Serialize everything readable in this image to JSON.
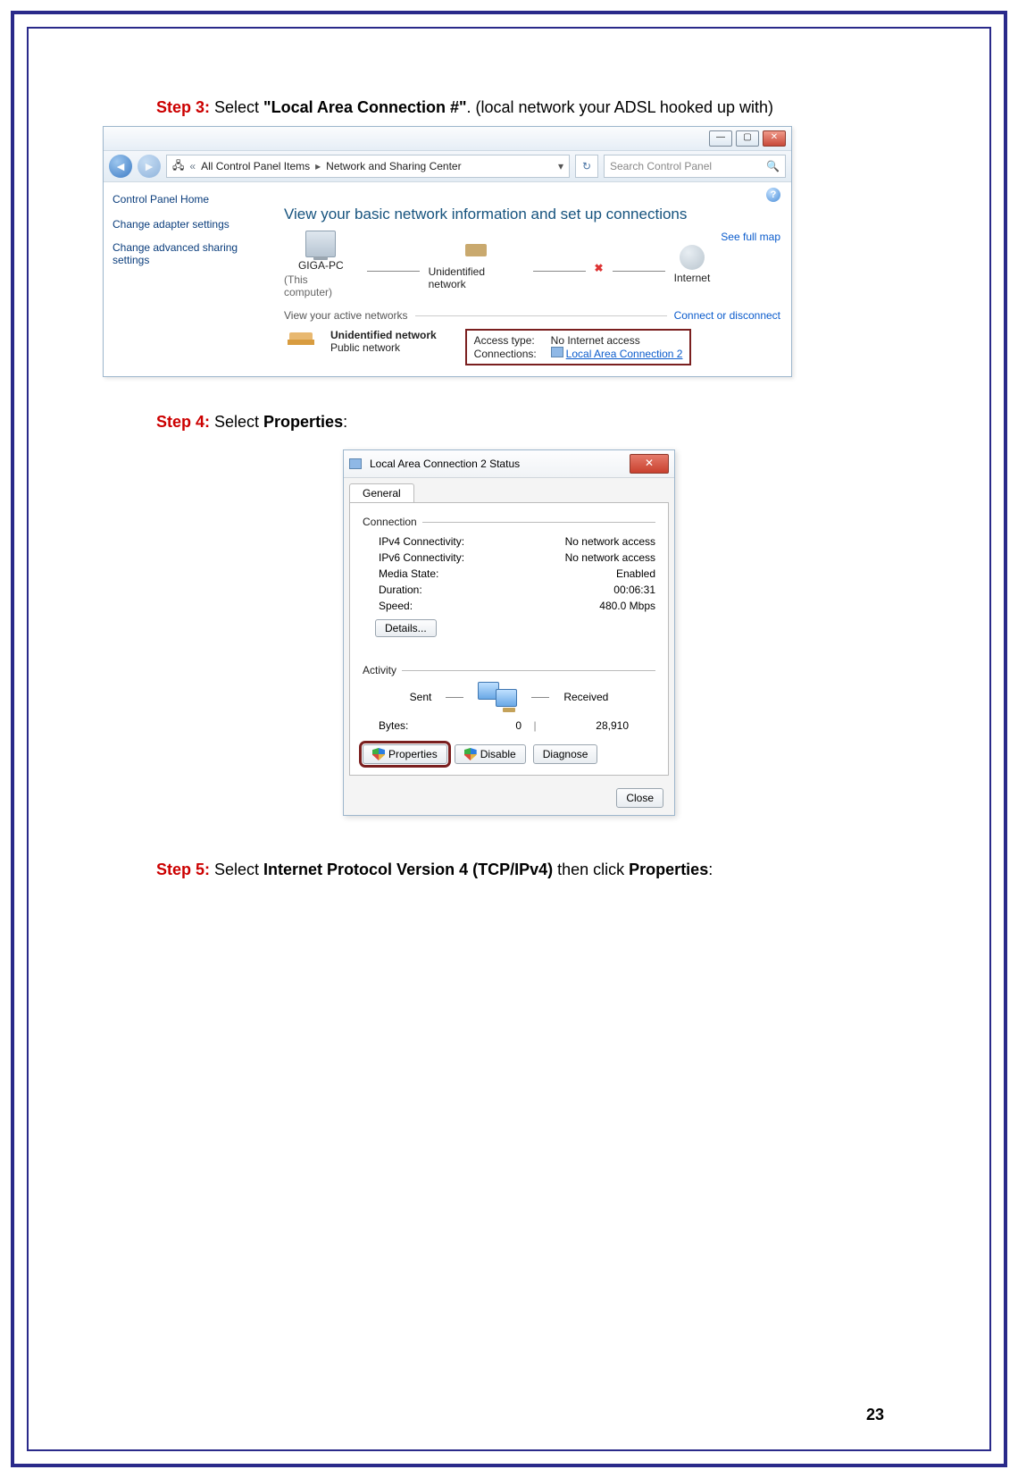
{
  "page_number": "23",
  "step3": {
    "label": "Step 3:",
    "pre": " Select ",
    "bold": "\"Local Area Connection #\"",
    "post": ". (local network your ADSL hooked up with)"
  },
  "step4": {
    "label": "Step 4:",
    "pre": " Select ",
    "bold": "Properties",
    "post": ":"
  },
  "step5": {
    "label": "Step 5:",
    "pre": " Select ",
    "bold1": "Internet Protocol Version 4 (TCP/IPv4)",
    "mid": " then click ",
    "bold2": "Properties",
    "post": ":"
  },
  "ncenter": {
    "breadcrumb_a": "All Control Panel Items",
    "breadcrumb_b": "Network and Sharing Center",
    "search_placeholder": "Search Control Panel",
    "sidebar": {
      "home": "Control Panel Home",
      "link1": "Change adapter settings",
      "link2": "Change advanced sharing settings"
    },
    "banner": "View your basic network information and set up connections",
    "fullmap": "See full map",
    "node_pc": "GIGA-PC",
    "node_pc_sub": "(This computer)",
    "node_un": "Unidentified network",
    "node_inet": "Internet",
    "view_active": "View your active networks",
    "connect_line": "Connect or disconnect",
    "unet_name": "Unidentified network",
    "unet_type": "Public network",
    "access_k": "Access type:",
    "access_v": "No Internet access",
    "conn_k": "Connections:",
    "conn_v": "Local Area Connection 2"
  },
  "status": {
    "title": "Local Area Connection 2 Status",
    "tab": "General",
    "grp_conn": "Connection",
    "ipv4_k": "IPv4 Connectivity:",
    "ipv4_v": "No network access",
    "ipv6_k": "IPv6 Connectivity:",
    "ipv6_v": "No network access",
    "media_k": "Media State:",
    "media_v": "Enabled",
    "dur_k": "Duration:",
    "dur_v": "00:06:31",
    "speed_k": "Speed:",
    "speed_v": "480.0 Mbps",
    "details_btn": "Details...",
    "grp_act": "Activity",
    "sent": "Sent",
    "received": "Received",
    "bytes_label": "Bytes:",
    "bytes_sent": "0",
    "bytes_recv": "28,910",
    "properties_btn": "Properties",
    "disable_btn": "Disable",
    "diagnose_btn": "Diagnose",
    "close_btn": "Close"
  }
}
